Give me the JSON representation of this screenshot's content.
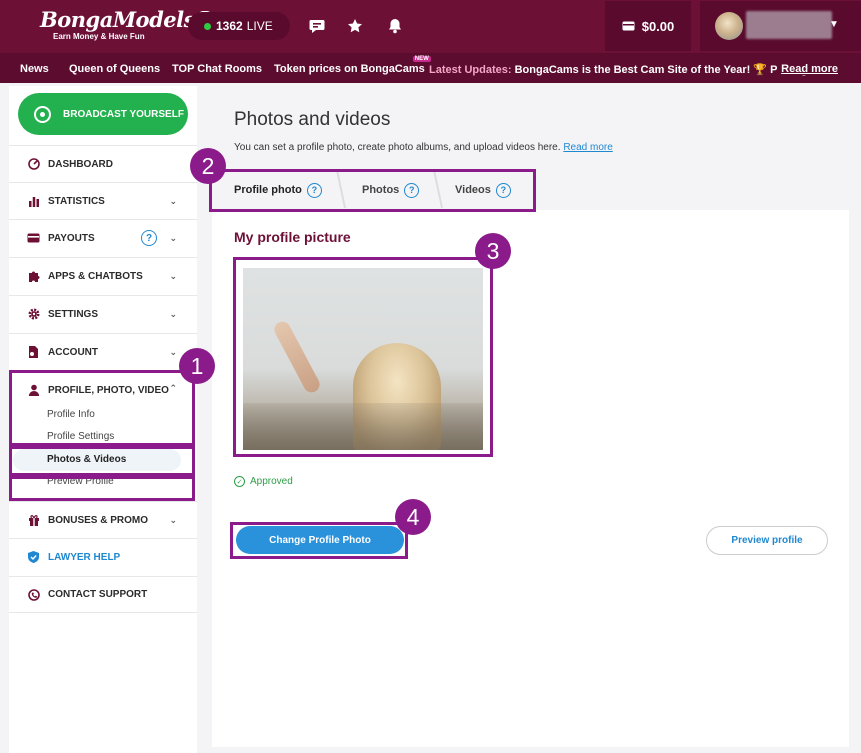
{
  "header": {
    "brand": "BongaModels",
    "tagline": "Earn Money & Have Fun",
    "live_count": "1362",
    "live_label": "LIVE",
    "balance": "$0.00",
    "icons": [
      "chat-icon",
      "star-icon",
      "bell-icon",
      "wallet-icon"
    ]
  },
  "nav": {
    "items": [
      "News",
      "Queen of Queens",
      "TOP Chat Rooms",
      "Token prices on BongaCams"
    ],
    "new_badge": "NEW",
    "latest_label": "Latest Updates:",
    "latest_text": "BongaCams is the Best Cam Site of the Year! 🏆 Prestigious",
    "read_more": "Read more"
  },
  "sidebar": {
    "broadcast": "BROADCAST YOURSELF",
    "items": [
      {
        "label": "DASHBOARD",
        "icon": "gauge-icon"
      },
      {
        "label": "STATISTICS",
        "icon": "bar-chart-icon"
      },
      {
        "label": "PAYOUTS",
        "icon": "card-icon",
        "help": "?"
      },
      {
        "label": "APPS & CHATBOTS",
        "icon": "puzzle-icon"
      },
      {
        "label": "SETTINGS",
        "icon": "gear-icon"
      },
      {
        "label": "ACCOUNT",
        "icon": "document-icon"
      },
      {
        "label": "PROFILE, PHOTO, VIDEO",
        "icon": "user-icon"
      },
      {
        "label": "BONUSES & PROMO",
        "icon": "gift-icon"
      },
      {
        "label": "LAWYER HELP",
        "icon": "shield-icon"
      },
      {
        "label": "CONTACT SUPPORT",
        "icon": "support-icon"
      }
    ],
    "sub_items": [
      "Profile Info",
      "Profile Settings",
      "Photos & Videos",
      "Preview Profile"
    ]
  },
  "main": {
    "title": "Photos and videos",
    "description": "You can set a profile photo, create photo albums, and upload videos here.",
    "read_more": "Read more",
    "tabs": [
      {
        "label": "Profile photo",
        "help": "?"
      },
      {
        "label": "Photos",
        "help": "?"
      },
      {
        "label": "Videos",
        "help": "?"
      }
    ],
    "panel_title": "My profile picture",
    "status": "Approved",
    "change_button": "Change Profile Photo",
    "preview_button": "Preview profile"
  },
  "annotations": [
    "1",
    "2",
    "3",
    "4"
  ],
  "colors": {
    "brand": "#6d1036",
    "accent": "#2a91db",
    "success": "#23b14f",
    "annotation": "#8b1a8b"
  }
}
